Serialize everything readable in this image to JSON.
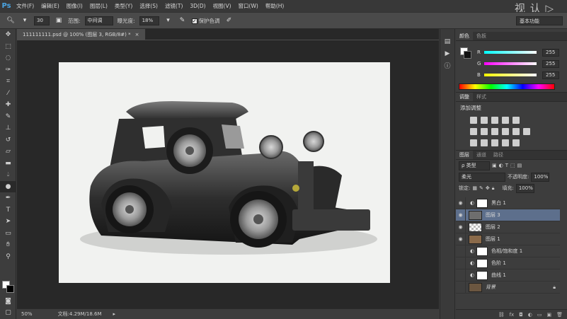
{
  "app": {
    "logo": "Ps",
    "watermark": "视 认 ▷"
  },
  "menu": [
    "文件(F)",
    "编辑(E)",
    "图像(I)",
    "图层(L)",
    "类型(Y)",
    "选择(S)",
    "滤镜(T)",
    "3D(D)",
    "视图(V)",
    "窗口(W)",
    "帮助(H)"
  ],
  "options": {
    "brush_size": "30",
    "range_label": "范围:",
    "range_value": "中间调",
    "exposure_label": "曝光度:",
    "exposure_value": "18%",
    "protect_label": "保护色调",
    "workspace": "基本功能"
  },
  "document": {
    "tab": "111111111.psd @ 100% (图层 3, RGB/8#) *",
    "zoom": "50%",
    "doc_size": "文档:4.29M/18.6M"
  },
  "color_panel": {
    "tabs": [
      "颜色",
      "色板"
    ],
    "channels": [
      {
        "name": "R",
        "value": "255",
        "color": "#e23a3a"
      },
      {
        "name": "G",
        "value": "255",
        "color": "#3ad03a"
      },
      {
        "name": "B",
        "value": "255",
        "color": "#3a5ae2"
      }
    ]
  },
  "adj_panel": {
    "tabs": [
      "调整",
      "样式"
    ],
    "title": "添加调整"
  },
  "layers_panel": {
    "tabs": [
      "图层",
      "通道",
      "路径"
    ],
    "filter": "ρ 类型",
    "blend": "柔光",
    "opacity_label": "不透明度:",
    "opacity": "100%",
    "lock_label": "锁定:",
    "fill_label": "填充:",
    "fill": "100%",
    "layers": [
      {
        "name": "黑白 1",
        "visible": true,
        "selected": false,
        "kind": "adjust"
      },
      {
        "name": "图层 3",
        "visible": true,
        "selected": true,
        "kind": "gray"
      },
      {
        "name": "图层 2",
        "visible": true,
        "selected": false,
        "kind": "checker"
      },
      {
        "name": "图层 1",
        "visible": true,
        "selected": false,
        "kind": "car"
      },
      {
        "name": "色相/饱和度 1",
        "visible": false,
        "selected": false,
        "kind": "adjust"
      },
      {
        "name": "色阶 1",
        "visible": false,
        "selected": false,
        "kind": "adjust"
      },
      {
        "name": "曲线 1",
        "visible": false,
        "selected": false,
        "kind": "adjust"
      },
      {
        "name": "背景",
        "visible": false,
        "selected": false,
        "kind": "car"
      }
    ]
  }
}
